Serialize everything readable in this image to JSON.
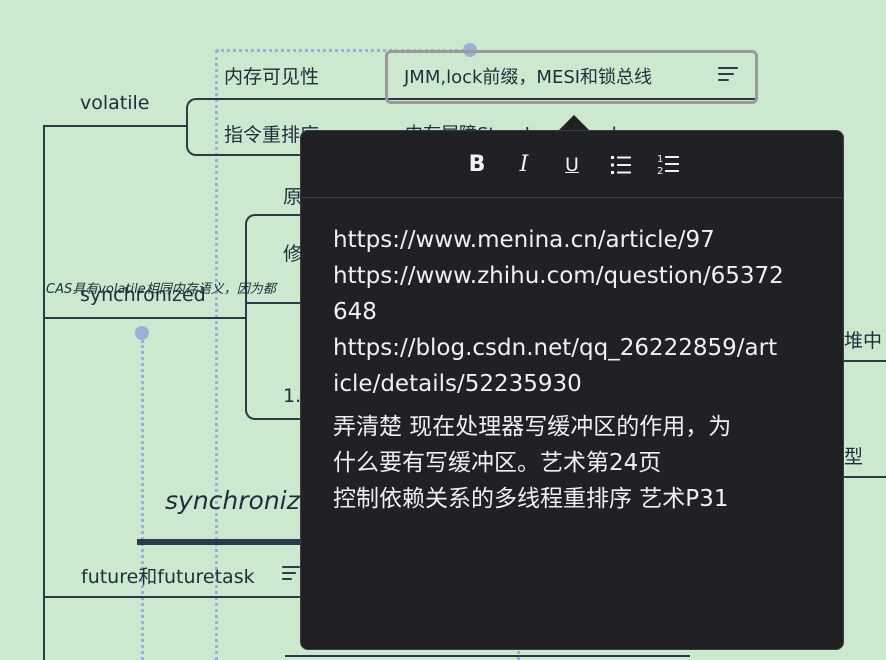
{
  "mindmap": {
    "volatile_label": "volatile",
    "visibility_label": "内存可见性",
    "visibility_note": "JMM,lock前缀，MESI和锁总线",
    "reorder_label": "指令重排序",
    "reorder_note": "内存屏障StoreLoad Load",
    "synchronized_label": "synchronized",
    "cas_label": "CAS具有volatile相同内存语义，因为都",
    "partial_yuan": "原",
    "partial_xiu": "修",
    "partial_one": "1.",
    "sync_heading": "synchroniz",
    "future_label": "future和futuretask",
    "right_partial_1": "堆中",
    "right_partial_2": "型"
  },
  "editor": {
    "toolbar": {
      "bold": "B",
      "italic": "I",
      "underline": "U"
    },
    "lines": [
      "https://www.menina.cn/article/97",
      "https://www.zhihu.com/question/65372",
      "648",
      "https://blog.csdn.net/qq_26222859/art",
      "icle/details/52235930",
      "弄清楚  现在处理器写缓冲区的作用，为",
      "什么要有写缓冲区。艺术第24页",
      "控制依赖关系的多线程重排序   艺术P31"
    ]
  }
}
